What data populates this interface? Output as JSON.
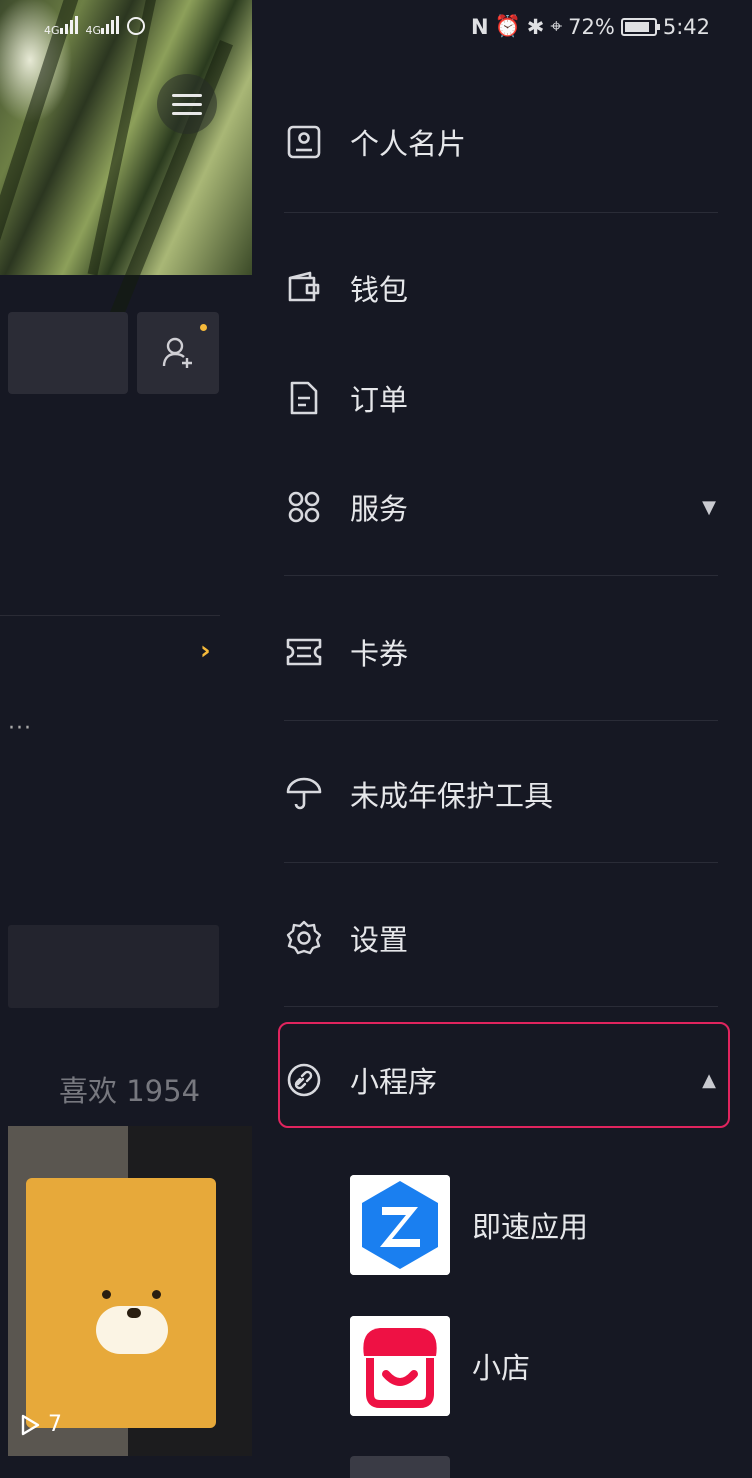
{
  "status_bar": {
    "network_1": "4G",
    "network_2": "4G",
    "battery_percent": "72%",
    "time": "5:42"
  },
  "profile": {
    "likes_label": "喜欢 1954",
    "video_play_count": "7"
  },
  "drawer": {
    "items": [
      {
        "label": "个人名片",
        "icon": "business-card-icon"
      },
      {
        "label": "钱包",
        "icon": "wallet-icon"
      },
      {
        "label": "订单",
        "icon": "order-document-icon"
      },
      {
        "label": "服务",
        "icon": "services-grid-icon",
        "expand": "collapsed"
      },
      {
        "label": "卡券",
        "icon": "coupon-ticket-icon"
      },
      {
        "label": "未成年保护工具",
        "icon": "umbrella-icon"
      },
      {
        "label": "设置",
        "icon": "gear-icon"
      },
      {
        "label": "小程序",
        "icon": "link-icon",
        "expand": "expanded",
        "highlighted": true
      }
    ],
    "mini_programs": [
      {
        "label": "即速应用",
        "icon": "jisu-app-icon",
        "color": "#1a7ff0"
      },
      {
        "label": "小店",
        "icon": "shop-icon",
        "color": "#ee1144"
      }
    ]
  },
  "colors": {
    "background": "#161823",
    "highlight_border": "#e0245e",
    "accent_yellow": "#f5b93a"
  }
}
